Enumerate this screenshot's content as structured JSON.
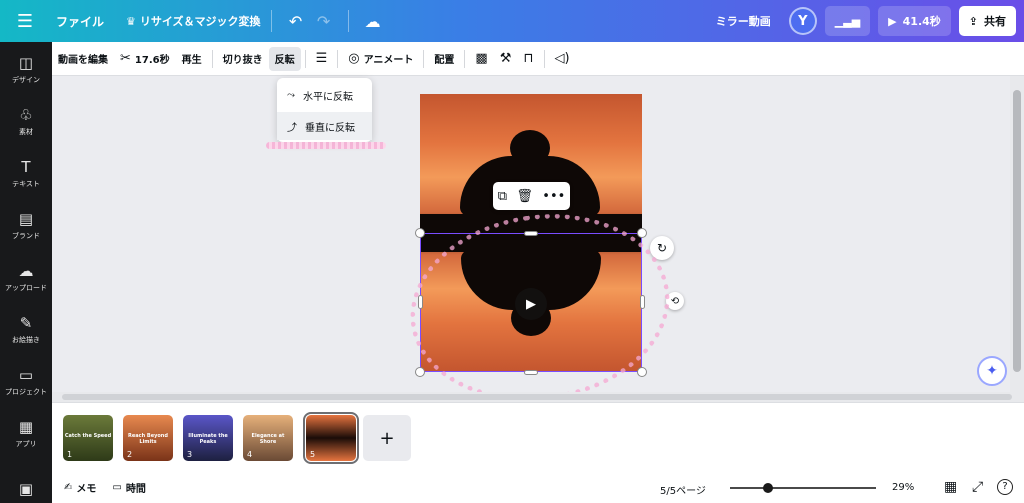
{
  "topbar": {
    "file": "ファイル",
    "resize": "リサイズ＆マジック変換",
    "title": "ミラー動画",
    "avatar": "Y",
    "duration": "41.4秒",
    "share": "共有"
  },
  "sidebar": {
    "items": [
      {
        "icon": "◫",
        "label": "デザイン"
      },
      {
        "icon": "♧",
        "label": "素材"
      },
      {
        "icon": "T",
        "label": "テキスト"
      },
      {
        "icon": "▤",
        "label": "ブランド"
      },
      {
        "icon": "☁",
        "label": "アップロード"
      },
      {
        "icon": "✎",
        "label": "お絵描き"
      },
      {
        "icon": "▭",
        "label": "プロジェクト"
      },
      {
        "icon": "▦",
        "label": "アプリ"
      }
    ]
  },
  "toolbar": {
    "edit_video": "動画を編集",
    "trim_time": "17.6秒",
    "play": "再生",
    "crop": "切り抜き",
    "flip": "反転",
    "animate": "アニメート",
    "position": "配置"
  },
  "flip_menu": {
    "horizontal": "水平に反転",
    "vertical": "垂直に反転"
  },
  "pages": [
    {
      "num": "1",
      "caption": "Catch the Speed",
      "bg": "#5a6a30"
    },
    {
      "num": "2",
      "caption": "Reach Beyond Limits",
      "bg": "#e07040"
    },
    {
      "num": "3",
      "caption": "Illuminate the Peaks",
      "bg": "#3a4a9a"
    },
    {
      "num": "4",
      "caption": "Elegance at Shore",
      "bg": "#d09060"
    },
    {
      "num": "5",
      "caption": "",
      "bg": "#e06a3a"
    }
  ],
  "footer": {
    "memo": "メモ",
    "time": "時間",
    "page_indicator": "5/5ページ",
    "zoom": "29%",
    "zoom_level": 0.29
  }
}
